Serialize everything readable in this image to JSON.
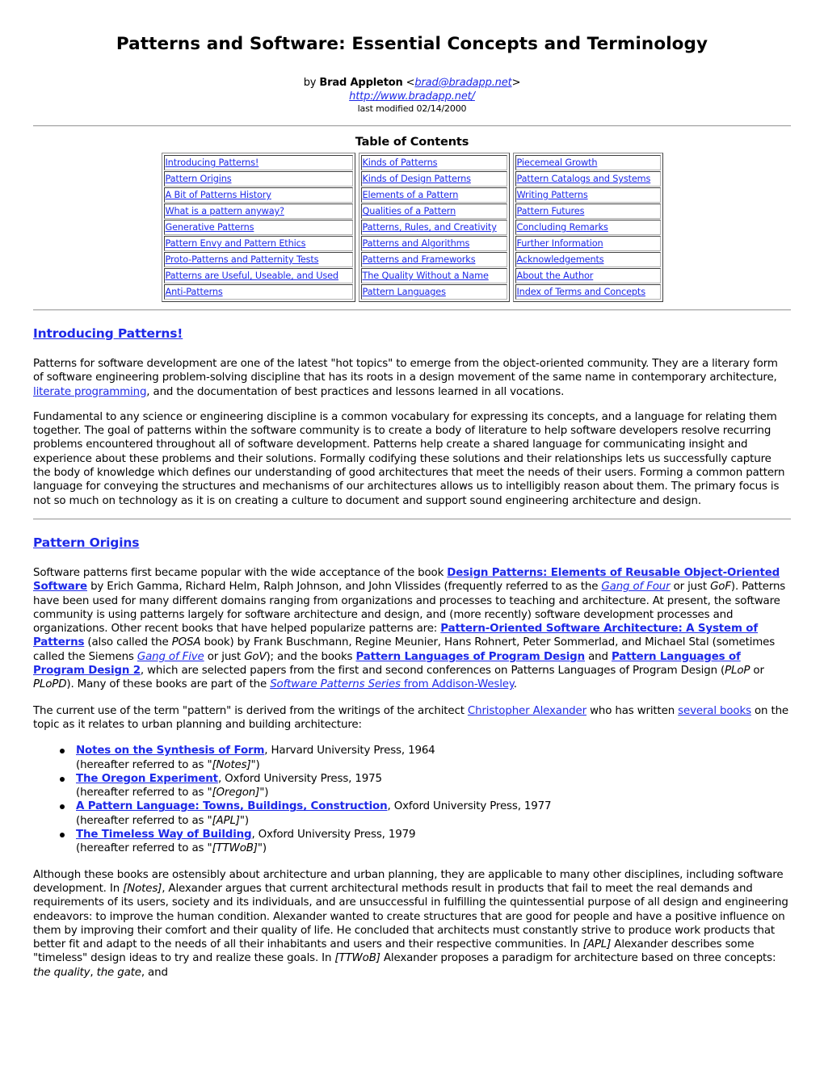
{
  "title": "Patterns and Software: Essential Concepts and Terminology",
  "byline": {
    "by": "by ",
    "author": "Brad Appleton",
    "lt": " <",
    "email": "brad@bradapp.net",
    "gt": ">",
    "url": "http://www.bradapp.net/",
    "modified": "last modified 02/14/2000"
  },
  "toc": {
    "title": "Table of Contents",
    "columns": [
      [
        "Introducing Patterns!",
        "Pattern Origins",
        "A Bit of Patterns History",
        "What is a pattern anyway?",
        "Generative Patterns",
        "Pattern Envy and Pattern Ethics",
        "Proto-Patterns and Patternity Tests",
        "Patterns are Useful, Useable, and Used",
        "Anti-Patterns"
      ],
      [
        "Kinds of Patterns",
        "Kinds of Design Patterns",
        "Elements of a Pattern",
        "Qualities of a Pattern",
        "Patterns, Rules, and Creativity",
        "Patterns and Algorithms",
        "Patterns and Frameworks",
        "The Quality Without a Name",
        "Pattern Languages"
      ],
      [
        "Piecemeal Growth",
        "Pattern Catalogs and Systems",
        "Writing Patterns",
        "Pattern Futures",
        "Concluding Remarks",
        "Further Information",
        "Acknowledgements",
        "About the Author",
        "Index of Terms and Concepts"
      ]
    ]
  },
  "sections": {
    "intro": {
      "heading": "Introducing Patterns!",
      "p1": {
        "a": "Patterns for software development are one of the latest \"hot topics\" to emerge from the object-oriented community. They are a literary form of software engineering problem-solving discipline that has its roots in a design movement of the same name in contemporary architecture, ",
        "link": "literate programming",
        "b": ", and the documentation of best practices and lessons learned in all vocations."
      },
      "p2": "Fundamental to any science or engineering discipline is a common vocabulary for expressing its concepts, and a language for relating them together. The goal of patterns within the software community is to create a body of literature to help software developers resolve recurring problems encountered throughout all of software development. Patterns help create a shared language for communicating insight and experience about these problems and their solutions. Formally codifying these solutions and their relationships lets us successfully capture the body of knowledge which defines our understanding of good architectures that meet the needs of their users. Forming a common pattern language for conveying the structures and mechanisms of our architectures allows us to intelligibly reason about them. The primary focus is not so much on technology as it is on creating a culture to document and support sound engineering architecture and design."
    },
    "origins": {
      "heading": "Pattern Origins",
      "p1": {
        "t1": "Software patterns first became popular with the wide acceptance of the book ",
        "l1": "Design Patterns: Elements of Reusable Object-Oriented Software",
        "t2": " by Erich Gamma, Richard Helm, Ralph Johnson, and John Vlissides (frequently referred to as the ",
        "l2": "Gang of Four",
        "t3": " or just ",
        "i1": "GoF",
        "t4": "). Patterns have been used for many different domains ranging from organizations and processes to teaching and architecture. At present, the software community is using patterns largely for software architecture and design, and (more recently) software development processes and organizations. Other recent books that have helped popularize patterns are: ",
        "l3": "Pattern-Oriented Software Architecture: A System of Patterns",
        "t5": " (also called the ",
        "i2": "POSA",
        "t6": " book) by Frank Buschmann, Regine Meunier, Hans Rohnert, Peter Sommerlad, and Michael Stal (sometimes called the Siemens ",
        "l4": "Gang of Five",
        "t7": " or just ",
        "i3": "GoV",
        "t8": "); and the books ",
        "l5": "Pattern Languages of Program Design",
        "t9": " and ",
        "l6": "Pattern Languages of Program Design 2",
        "t10": ", which are selected papers from the first and second conferences on Patterns Languages of Program Design (",
        "i4": "PLoP",
        "t11": " or ",
        "i5": "PLoPD",
        "t12": "). Many of these books are part of the ",
        "l7": "Software Patterns Series",
        "l7b": " from Addison-Wesley",
        "t13": "."
      },
      "p2": {
        "t1": "The current use of the term \"pattern\" is derived from the writings of the architect ",
        "l1": "Christopher Alexander",
        "t2": " who has written ",
        "l2": "several books",
        "t3": " on the topic as it relates to urban planning and building architecture:"
      },
      "books": [
        {
          "title": "Notes on the Synthesis of Form",
          "pub": ", Harvard University Press, 1964",
          "ref_pre": "(hereafter referred to as \"",
          "ref": "[Notes]",
          "ref_post": "\")"
        },
        {
          "title": "The Oregon Experiment",
          "pub": ", Oxford University Press, 1975",
          "ref_pre": "(hereafter referred to as \"",
          "ref": "[Oregon]",
          "ref_post": "\")"
        },
        {
          "title": "A Pattern Language: Towns, Buildings, Construction",
          "pub": ", Oxford University Press, 1977",
          "ref_pre": "(hereafter referred to as \"",
          "ref": "[APL]",
          "ref_post": "\")"
        },
        {
          "title": "The Timeless Way of Building",
          "pub": ", Oxford University Press, 1979",
          "ref_pre": "(hereafter referred to as \"",
          "ref": "[TTWoB]",
          "ref_post": "\")"
        }
      ],
      "p3": {
        "t1": "Although these books are ostensibly about architecture and urban planning, they are applicable to many other disciplines, including software development. In ",
        "i1": "[Notes]",
        "t2": ", Alexander argues that current architectural methods result in products that fail to meet the real demands and requirements of its users, society and its individuals, and are unsuccessful in fulfilling the quintessential purpose of all design and engineering endeavors: to improve the human condition. Alexander wanted to create structures that are good for people and have a positive influence on them by improving their comfort and their quality of life. He concluded that architects must constantly strive to produce work products that better fit and adapt to the needs of all their inhabitants and users and their respective communities. In ",
        "i2": "[APL]",
        "t3": " Alexander describes some \"timeless\" design ideas to try and realize these goals. In ",
        "i3": "[TTWoB]",
        "t4": " Alexander proposes a paradigm for architecture based on three concepts: ",
        "i4": "the quality",
        "t5": ", ",
        "i5": "the gate",
        "t6": ", and"
      }
    }
  }
}
